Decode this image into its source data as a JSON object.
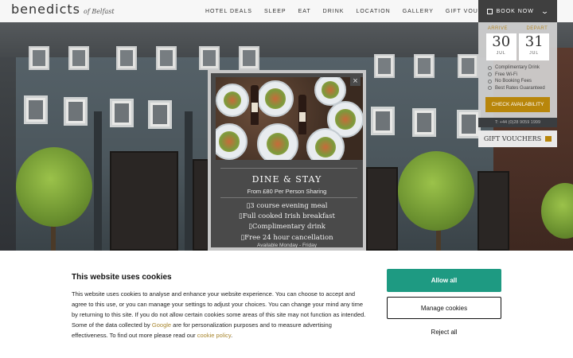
{
  "header": {
    "logo_main": "benedicts",
    "logo_sub": "of Belfast",
    "nav": [
      "HOTEL DEALS",
      "SLEEP",
      "EAT",
      "DRINK",
      "LOCATION",
      "GALLERY",
      "GIFT VOUCHERS"
    ],
    "book_label": "BOOK NOW"
  },
  "booking": {
    "arrive_label": "ARRIVE",
    "depart_label": "DEPART",
    "arrive_day": "30",
    "arrive_month": "JUL",
    "depart_day": "31",
    "depart_month": "JUL",
    "perks": [
      "Complimentary Drink",
      "Free Wi-Fi",
      "No Booking Fees",
      "Best Rates Guaranteed"
    ],
    "check_label": "CHECK AVAILABILITY",
    "phone": "T: +44 (0)28 9059 1999",
    "gift_label": "GIFT VOUCHERS"
  },
  "popup": {
    "close": "×",
    "title": "DINE & STAY",
    "subtitle": "From £80 Per Person Sharing",
    "items": [
      "3 course evening meal",
      "Full cooked Irish breakfast",
      "Complimentary drink",
      "Free 24 hour cancellation"
    ],
    "availability": "Available Monday - Friday"
  },
  "cookie": {
    "title": "This website uses cookies",
    "text_before_google": "This website uses cookies to analyse and enhance your website experience. You can choose to accept and agree to this use, or you can manage your settings to adjust your choices. You can change your mind any time by returning to this site. If you do not allow certain cookies some areas of this site may not function as intended. Some of the data collected by ",
    "google_link": "Google",
    "text_middle": " are for personalization purposes and to measure advertising effectiveness. To find out more please read our ",
    "policy_link": "cookie policy",
    "text_end": ".",
    "allow_label": "Allow all",
    "manage_label": "Manage cookies",
    "reject_label": "Reject all"
  }
}
